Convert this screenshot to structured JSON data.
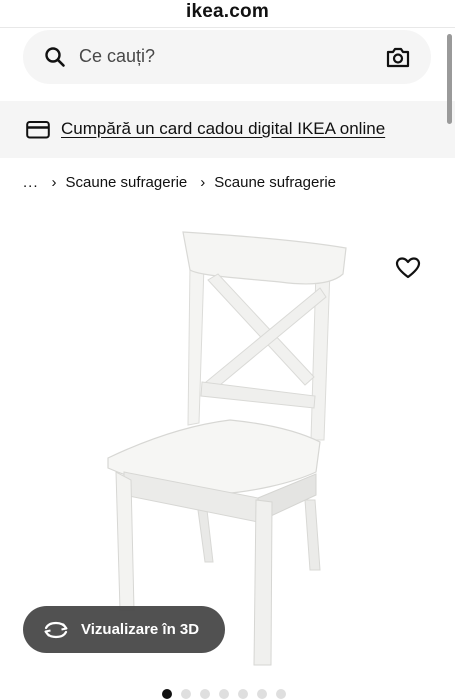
{
  "browser": {
    "url": "ikea.com"
  },
  "search": {
    "placeholder": "Ce cauți?"
  },
  "promo": {
    "gift_card_link": "Cumpără un card cadou digital IKEA online"
  },
  "breadcrumb": {
    "items": [
      "...",
      "Scaune sufragerie",
      "Scaune sufragerie"
    ]
  },
  "viewer": {
    "view_3d_label": "Vizualizare în 3D"
  },
  "gallery": {
    "image_count": 7,
    "active_index": 0
  },
  "icons": {
    "search": "search-icon",
    "camera": "camera-icon",
    "card": "gift-card-icon",
    "favourite": "heart-icon",
    "rotate": "rotate-3d-icon",
    "chevron": "chevron-right-icon"
  },
  "colors": {
    "search_bg": "#f5f5f5",
    "button_bg": "#484848",
    "dot_active": "#111111",
    "dot_inactive": "#dfdfdf"
  }
}
